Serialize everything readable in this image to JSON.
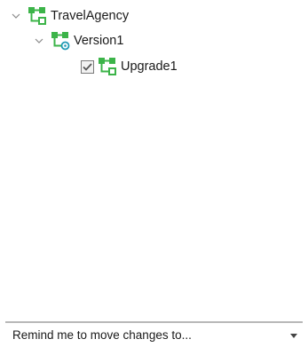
{
  "tree": {
    "nodes": [
      {
        "label": "TravelAgency",
        "icon": "branch-icon",
        "expanded": true
      },
      {
        "label": "Version1",
        "icon": "branch-version-icon",
        "expanded": true
      },
      {
        "label": "Upgrade1",
        "icon": "branch-icon",
        "checked": true
      }
    ]
  },
  "footer": {
    "label": "Remind me to move changes to..."
  },
  "colors": {
    "accent_green": "#3cb449",
    "accent_teal": "#1f9ab5",
    "chevron": "#8a8a8a",
    "divider": "#b8b8b8"
  }
}
